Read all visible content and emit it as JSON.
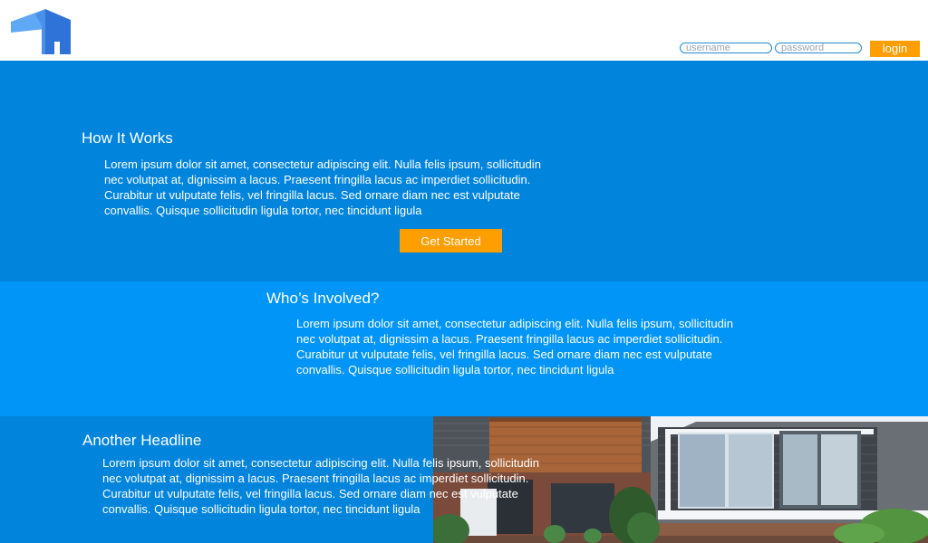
{
  "header": {
    "logo_icon": "house-logo-icon",
    "username_placeholder": "username",
    "password_placeholder": "password",
    "login_label": "login"
  },
  "sections": [
    {
      "title": "How It Works",
      "body": "Lorem ipsum dolor sit amet, consectetur adipiscing elit. Nulla felis ipsum, sol­licitudin nec volutpat at, dignissim a lacus. Praesent fringilla lacus ac imperdiet sollicitudin. Curabitur ut vulputate felis, vel fringilla lacus. Sed ornare diam nec est vulputate convallis. Quisque sollicitudin ligula tortor, nec tincidunt ligula",
      "cta_label": "Get Started"
    },
    {
      "title": "Who’s Involved?",
      "body": "Lorem ipsum dolor sit amet, consectetur adipiscing elit. Nulla felis ipsum, sol­licitudin nec volutpat at, dignissim a lacus. Praesent fringilla lacus ac imperdiet sollicitudin. Curabitur ut vulputate felis, vel fringilla lacus. Sed ornare diam nec est vulputate convallis. Quisque sollicitudin ligula tortor, nec tincidunt ligula"
    },
    {
      "title": "Another Headline",
      "body": "Lorem ipsum dolor sit amet, consectetur adipiscing elit. Nulla felis ipsum, sol­licitudin nec volutpat at, dignissim a lacus. Praesent fringilla lacus ac imperdiet sollicitudin. Curabitur ut vulputate felis, vel fringilla lacus. Sed ornare diam nec est vulputate convallis. Quisque sollicitudin ligula tortor, nec tincidunt ligula",
      "image": "modern-house-photo"
    }
  ],
  "colors": {
    "header_bg": "#ffffff",
    "section_dark": "#0084dc",
    "section_light": "#0095f6",
    "accent": "#ff9e00"
  }
}
